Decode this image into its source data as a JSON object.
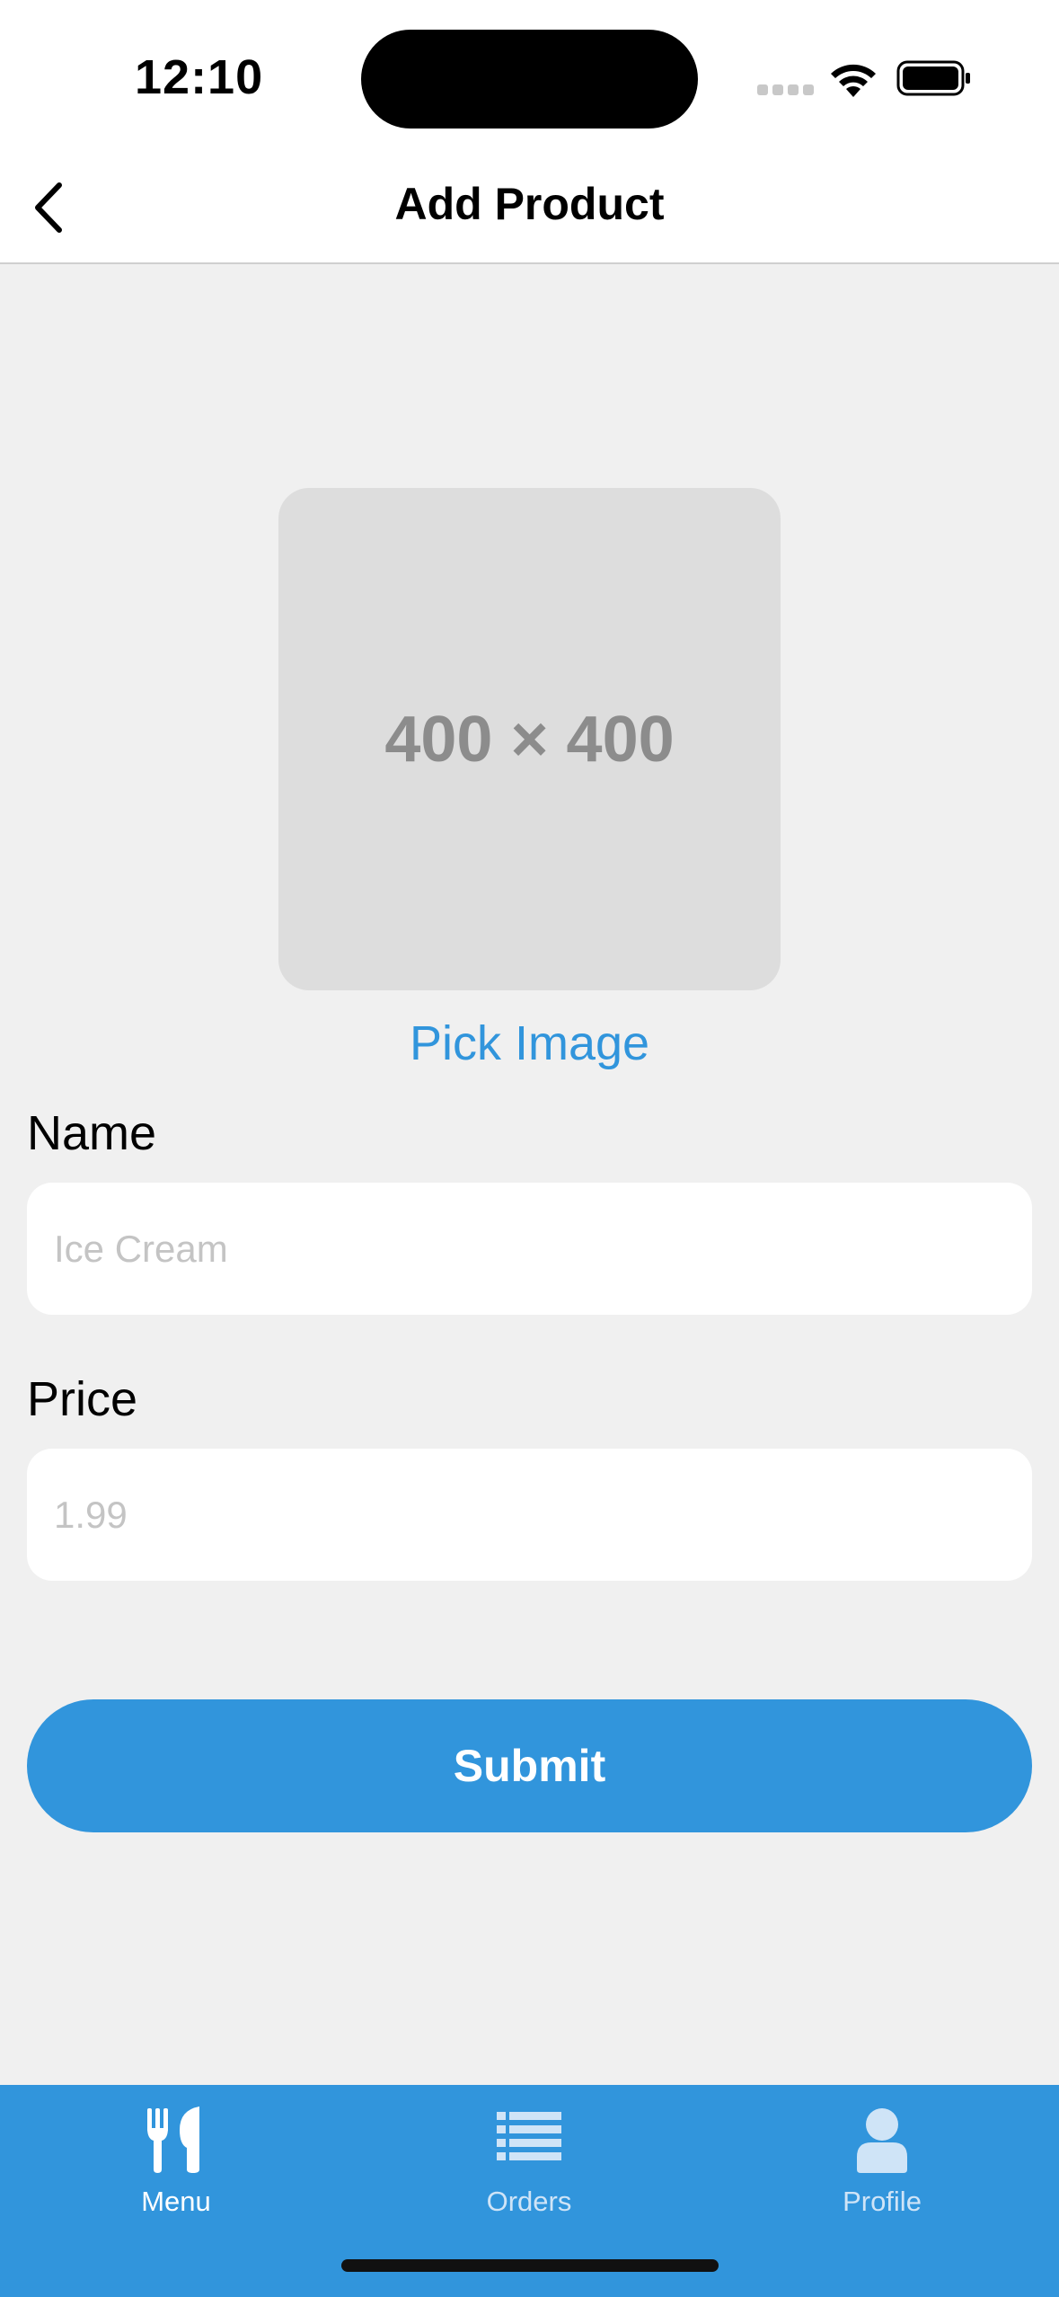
{
  "status_bar": {
    "time": "12:10"
  },
  "nav": {
    "title": "Add Product"
  },
  "image_picker": {
    "placeholder_text": "400 × 400",
    "pick_label": "Pick Image"
  },
  "form": {
    "name_label": "Name",
    "name_placeholder": "Ice Cream",
    "name_value": "",
    "price_label": "Price",
    "price_placeholder": "1.99",
    "price_value": "",
    "submit_label": "Submit"
  },
  "tab_bar": {
    "items": [
      {
        "label": "Menu",
        "icon": "fork-knife-icon",
        "active": true
      },
      {
        "label": "Orders",
        "icon": "list-icon",
        "active": false
      },
      {
        "label": "Profile",
        "icon": "user-icon",
        "active": false
      }
    ]
  },
  "colors": {
    "accent": "#3195dc",
    "background": "#f0f0f0",
    "placeholder_box": "#dddddd"
  }
}
